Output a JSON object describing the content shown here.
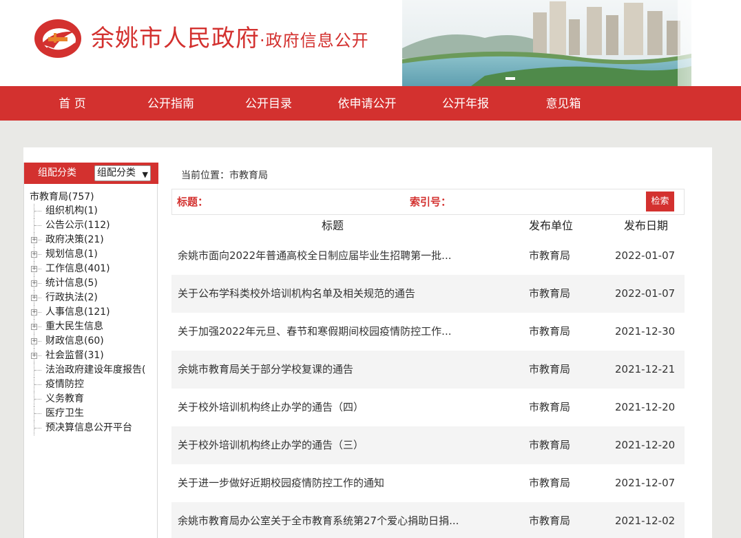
{
  "header": {
    "title_main": "余姚市人民政府",
    "title_dot": "·",
    "title_sub": "政府信息公开"
  },
  "nav": {
    "items": [
      "首 页",
      "公开指南",
      "公开目录",
      "依申请公开",
      "公开年报",
      "意见箱"
    ]
  },
  "sidebar": {
    "head_label": "组配分类",
    "select_value": "组配分类",
    "root": "市教育局(757)",
    "items": [
      {
        "label": "组织机构(1)",
        "expandable": false
      },
      {
        "label": "公告公示(112)",
        "expandable": false
      },
      {
        "label": "政府决策(21)",
        "expandable": true
      },
      {
        "label": "规划信息(1)",
        "expandable": true
      },
      {
        "label": "工作信息(401)",
        "expandable": true
      },
      {
        "label": "统计信息(5)",
        "expandable": true
      },
      {
        "label": "行政执法(2)",
        "expandable": true
      },
      {
        "label": "人事信息(121)",
        "expandable": true
      },
      {
        "label": "重大民生信息",
        "expandable": true
      },
      {
        "label": "财政信息(60)",
        "expandable": true
      },
      {
        "label": "社会监督(31)",
        "expandable": true
      },
      {
        "label": "法治政府建设年度报告(",
        "expandable": false
      },
      {
        "label": "疫情防控",
        "expandable": false
      },
      {
        "label": "义务教育",
        "expandable": false
      },
      {
        "label": "医疗卫生",
        "expandable": false
      },
      {
        "label": "预决算信息公开平台",
        "expandable": false
      }
    ]
  },
  "breadcrumb": "当前位置：市教育局",
  "search": {
    "title_label": "标题：",
    "index_label": "索引号：",
    "button_label": "检索"
  },
  "table": {
    "headers": [
      "标题",
      "发布单位",
      "发布日期"
    ],
    "rows": [
      {
        "title": "余姚市面向2022年普通高校全日制应届毕业生招聘第一批...",
        "unit": "市教育局",
        "date": "2022-01-07"
      },
      {
        "title": "关于公布学科类校外培训机构名单及相关规范的通告",
        "unit": "市教育局",
        "date": "2022-01-07"
      },
      {
        "title": "关于加强2022年元旦、春节和寒假期间校园疫情防控工作...",
        "unit": "市教育局",
        "date": "2021-12-30"
      },
      {
        "title": "余姚市教育局关于部分学校复课的通告",
        "unit": "市教育局",
        "date": "2021-12-21"
      },
      {
        "title": "关于校外培训机构终止办学的通告（四）",
        "unit": "市教育局",
        "date": "2021-12-20"
      },
      {
        "title": "关于校外培训机构终止办学的通告（三）",
        "unit": "市教育局",
        "date": "2021-12-20"
      },
      {
        "title": "关于进一步做好近期校园疫情防控工作的通知",
        "unit": "市教育局",
        "date": "2021-12-07"
      },
      {
        "title": "余姚市教育局办公室关于全市教育系统第27个爱心捐助日捐...",
        "unit": "市教育局",
        "date": "2021-12-02"
      }
    ]
  },
  "colors": {
    "brand_red": "#d3312f",
    "page_bg": "#e9e9e6",
    "row_alt": "#f4f4f4"
  },
  "icons": {
    "logo": "government-emblem-logo",
    "banner": "city-riverside-photo",
    "tree_expand": "plus-box-icon",
    "select_caret": "chevron-down-icon"
  }
}
